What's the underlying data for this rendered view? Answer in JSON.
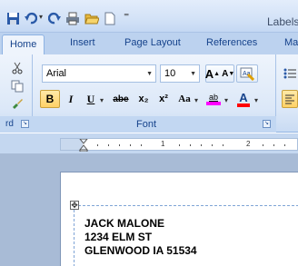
{
  "window": {
    "title": "Labels"
  },
  "quick_access": [
    {
      "name": "save-icon"
    },
    {
      "name": "undo-icon"
    },
    {
      "name": "redo-icon"
    },
    {
      "name": "print-icon"
    },
    {
      "name": "open-icon"
    },
    {
      "name": "new-document-icon"
    }
  ],
  "tabs": [
    {
      "label": "Home",
      "active": true
    },
    {
      "label": "Insert"
    },
    {
      "label": "Page Layout"
    },
    {
      "label": "References"
    },
    {
      "label": "Ma"
    }
  ],
  "clipboard": {
    "footer_label": "rd"
  },
  "font_group": {
    "label": "Font",
    "font_name": "Arial",
    "font_size": "10",
    "bold": "B",
    "italic": "I",
    "underline": "U",
    "strikethrough": "abe",
    "subscript": "x₂",
    "superscript": "x²",
    "change_case": "Aa",
    "grow_font": "A",
    "shrink_font": "A",
    "highlight": "ab",
    "font_color": "A"
  },
  "ruler": {
    "numbers": [
      "1",
      "2"
    ]
  },
  "document": {
    "address_lines": [
      "JACK MALONE",
      "1234 ELM ST",
      "GLENWOOD IA  51534"
    ]
  },
  "colors": {
    "ribbon": "#dce8f8",
    "tab_bar": "#bcd2ef",
    "workspace": "#a8bbd6",
    "highlight_yellow": "#ffff00",
    "font_color_red": "#ff0000"
  }
}
